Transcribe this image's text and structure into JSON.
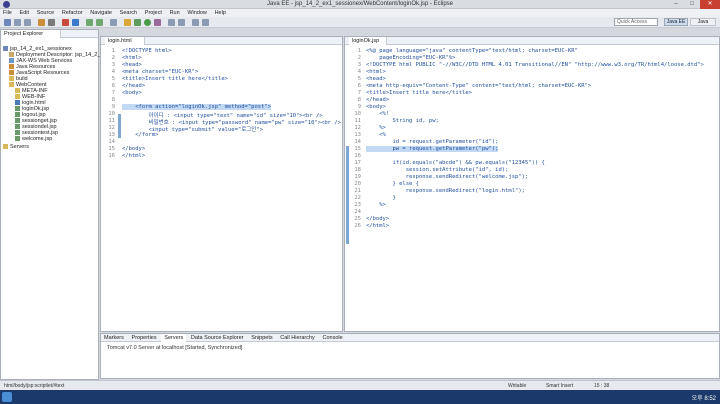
{
  "window": {
    "title": "Java EE - jsp_14_2_ex1_sessionex/WebContent/loginOk.jsp - Eclipse"
  },
  "menu": [
    "File",
    "Edit",
    "Source",
    "Refactor",
    "Navigate",
    "Search",
    "Project",
    "Run",
    "Window",
    "Help"
  ],
  "toolbar": {
    "quick_access": "Quick Access",
    "perspective": "Java EE",
    "perspective2": "Java"
  },
  "explorer": {
    "tab": "Project Explorer",
    "items": [
      "jsp_14_2_ex1_sessionex",
      "Deployment Descriptor: jsp_14_2_ex1",
      "JAX-WS Web Services",
      "Java Resources",
      "JavaScript Resources",
      "build",
      "WebContent",
      "META-INF",
      "WEB-INF",
      "login.html",
      "loginOk.jsp",
      "logout.jsp",
      "sessionget.jsp",
      "sessiondel.jsp",
      "sessiontest.jsp",
      "welcome.jsp",
      "Servers"
    ]
  },
  "editor_left": {
    "tab": "login.html",
    "lines": [
      "1",
      "2",
      "3",
      "4",
      "5",
      "6",
      "7",
      "8",
      "9",
      "10",
      "11",
      "12",
      "13",
      "14",
      "15",
      "16"
    ],
    "code": [
      "<!DOCTYPE html>",
      "<html>",
      "<head>",
      "<meta charset=\"EUC-KR\">",
      "<title>Insert title here</title>",
      "</head>",
      "<body>",
      "",
      "    <form action=\"loginOk.jsp\" method=\"post\">",
      "        아이디 : <input type=\"text\" name=\"id\" size=\"10\"><br />",
      "        비밀번호 : <input type=\"password\" name=\"pw\" size=\"10\"><br />",
      "        <input type=\"submit\" value=\"로그인\">",
      "    </form>",
      "",
      "</body>",
      "</html>"
    ]
  },
  "editor_right": {
    "tab": "loginOk.jsp",
    "lines": [
      "1",
      "2",
      "3",
      "4",
      "5",
      "6",
      "7",
      "8",
      "9",
      "10",
      "11",
      "12",
      "13",
      "14",
      "15",
      "16",
      "17",
      "18",
      "19",
      "20",
      "21",
      "22",
      "23",
      "24",
      "25",
      "26"
    ],
    "code": [
      "<%@ page language=\"java\" contentType=\"text/html; charset=EUC-KR\"",
      "    pageEncoding=\"EUC-KR\"%>",
      "<!DOCTYPE html PUBLIC \"-//W3C//DTD HTML 4.01 Transitional//EN\" \"http://www.w3.org/TR/html4/loose.dtd\">",
      "<html>",
      "<head>",
      "<meta http-equiv=\"Content-Type\" content=\"text/html; charset=EUC-KR\">",
      "<title>Insert title here</title>",
      "</head>",
      "<body>",
      "    <%!",
      "        String id, pw;",
      "    %>",
      "    <%",
      "        id = request.getParameter(\"id\");",
      "        pw = request.getParameter(\"pw\");",
      "",
      "        if(id.equals(\"abcde\") && pw.equals(\"12345\")) {",
      "            session.setAttribute(\"id\", id);",
      "            response.sendRedirect(\"welcome.jsp\");",
      "        } else {",
      "            response.sendRedirect(\"login.html\");",
      "        }",
      "    %>",
      "",
      "</body>",
      "</html>"
    ]
  },
  "bottom": {
    "tabs": [
      "Markers",
      "Properties",
      "Servers",
      "Data Source Explorer",
      "Snippets",
      "Call Hierarchy",
      "Console"
    ],
    "server": "Tomcat v7.0 Server at localhost  [Started, Synchronized]"
  },
  "status": {
    "path": "html/body/jsp:scriptlet/#text",
    "mode": "Writable",
    "insert": "Smart Insert",
    "pos": "15 : 38"
  },
  "taskbar": {
    "clock": "오후 8:52"
  },
  "colors": {
    "accent": "#1b3a6b",
    "selection": "#c3d9f3"
  }
}
